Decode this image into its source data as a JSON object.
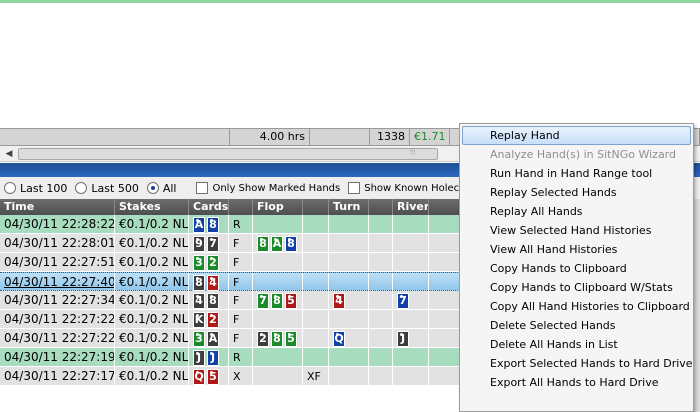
{
  "summary": {
    "duration": "4.00 hrs",
    "hands": "1338",
    "amount": "€1.71",
    "amount_color": "#1a8a2a"
  },
  "filters": {
    "last100": "Last 100",
    "last500": "Last 500",
    "all": "All",
    "marked": "Only Show Marked Hands",
    "holecards": "Show Known Holecards"
  },
  "grid": {
    "headers": {
      "time": "Time",
      "stakes": "Stakes",
      "cards": "Cards",
      "flop": "Flop",
      "turn": "Turn",
      "river": "River"
    },
    "rows": [
      {
        "time": "04/30/11 22:28:22",
        "stakes": "€0.1/0.2 NL",
        "c1": "A",
        "c2": "8",
        "pre": "R",
        "f1": "",
        "f2": "",
        "f3": "",
        "fa": "",
        "turn": "",
        "ta": "",
        "river": ""
      },
      {
        "time": "04/30/11 22:28:01",
        "stakes": "€0.1/0.2 NL",
        "c1": "9",
        "c2": "7",
        "pre": "F",
        "f1": "8",
        "f2": "A",
        "f3": "8",
        "fa": "",
        "turn": "",
        "ta": "",
        "river": ""
      },
      {
        "time": "04/30/11 22:27:51",
        "stakes": "€0.1/0.2 NL",
        "c1": "3",
        "c2": "2",
        "pre": "F",
        "f1": "",
        "f2": "",
        "f3": "",
        "fa": "",
        "turn": "",
        "ta": "",
        "river": ""
      },
      {
        "time": "04/30/11 22:27:40",
        "stakes": "€0.1/0.2 NL",
        "c1": "8",
        "c2": "4",
        "pre": "F",
        "f1": "",
        "f2": "",
        "f3": "",
        "fa": "",
        "turn": "",
        "ta": "",
        "river": ""
      },
      {
        "time": "04/30/11 22:27:34",
        "stakes": "€0.1/0.2 NL",
        "c1": "4",
        "c2": "8",
        "pre": "F",
        "f1": "7",
        "f2": "8",
        "f3": "5",
        "fa": "",
        "turn": "4",
        "ta": "",
        "river": "7"
      },
      {
        "time": "04/30/11 22:27:22",
        "stakes": "€0.1/0.2 NL",
        "c1": "K",
        "c2": "2",
        "pre": "F",
        "f1": "",
        "f2": "",
        "f3": "",
        "fa": "",
        "turn": "",
        "ta": "",
        "river": ""
      },
      {
        "time": "04/30/11 22:27:22",
        "stakes": "€0.1/0.2 NL",
        "c1": "3",
        "c2": "A",
        "pre": "F",
        "f1": "2",
        "f2": "8",
        "f3": "5",
        "fa": "",
        "turn": "Q",
        "ta": "",
        "river": "J"
      },
      {
        "time": "04/30/11 22:27:19",
        "stakes": "€0.1/0.2 NL",
        "c1": "J",
        "c2": "J",
        "pre": "R",
        "f1": "",
        "f2": "",
        "f3": "",
        "fa": "",
        "turn": "",
        "ta": "",
        "river": ""
      },
      {
        "time": "04/30/11 22:27:17",
        "stakes": "€0.1/0.2 NL",
        "c1": "Q",
        "c2": "5",
        "pre": "X",
        "f1": "",
        "f2": "",
        "f3": "",
        "fa": "XF",
        "turn": "",
        "ta": "",
        "river": ""
      }
    ]
  },
  "context_menu": {
    "items": [
      "Replay Hand",
      "Analyze Hand(s) in SitNGo Wizard",
      "Run Hand in Hand Range tool",
      "Replay Selected Hands",
      "Replay All Hands",
      "View Selected Hand Histories",
      "View All Hand Histories",
      "Copy Hands to Clipboard",
      "Copy Hands to Clipboard W/Stats",
      "Copy All Hand Histories to Clipboard",
      "Delete Selected Hands",
      "Delete All Hands in List",
      "Export Selected Hands to Hard Drive",
      "Export All Hands to Hard Drive"
    ]
  }
}
